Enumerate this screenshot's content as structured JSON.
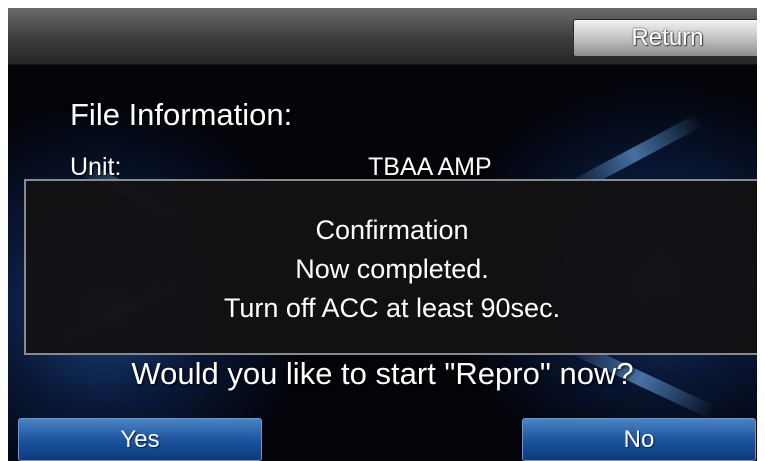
{
  "header": {
    "return_label": "Return"
  },
  "file_info": {
    "title": "File Information:",
    "unit_label": "Unit:",
    "unit_value": "TBAA AMP"
  },
  "dialog": {
    "title": "Confirmation",
    "line1": "Now completed.",
    "line2": "Turn off ACC at least 90sec."
  },
  "prompt": {
    "question": "Would you like to start \"Repro\" now?",
    "yes_label": "Yes",
    "no_label": "No"
  },
  "colors": {
    "background": "#030308",
    "button_blue": "#1d55a0",
    "return_button": "#c9c9c9"
  }
}
